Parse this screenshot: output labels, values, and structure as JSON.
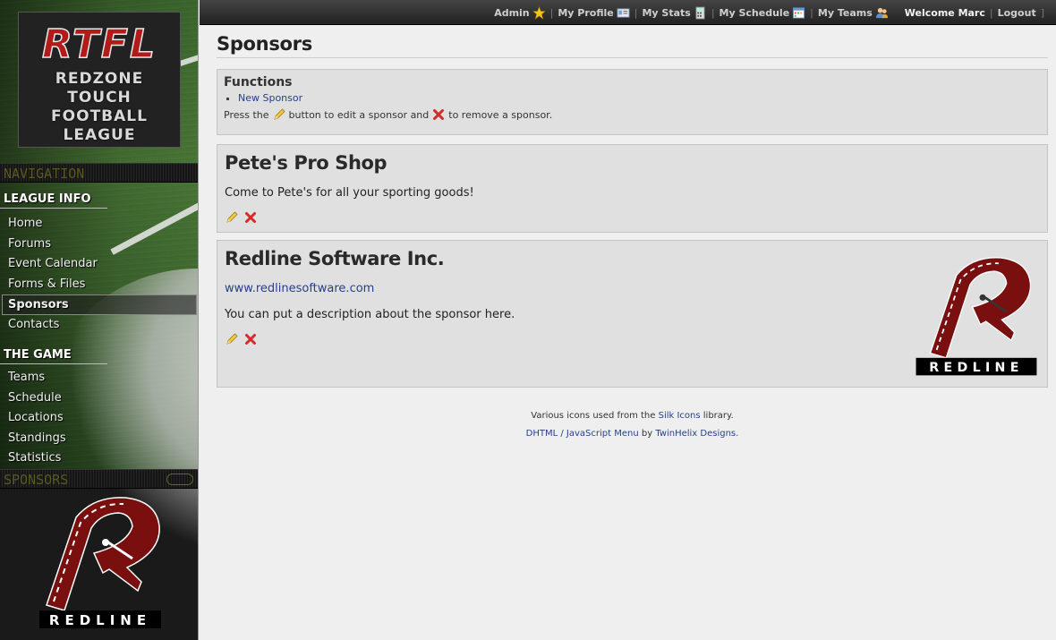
{
  "sidebar": {
    "logo": {
      "abbr": "RTFL",
      "line1": "REDZONE",
      "line2": "TOUCH",
      "line3": "FOOTBALL",
      "line4": "LEAGUE"
    },
    "navigation_bar": "NAVIGATION",
    "league_info": {
      "heading": "LEAGUE INFO",
      "items": [
        "Home",
        "Forums",
        "Event Calendar",
        "Forms & Files",
        "Sponsors",
        "Contacts"
      ],
      "active": "Sponsors"
    },
    "the_game": {
      "heading": "THE GAME",
      "items": [
        "Teams",
        "Schedule",
        "Locations",
        "Standings",
        "Statistics"
      ]
    },
    "sponsors_bar": "SPONSORS",
    "sponsor_logo_text": "REDLINE"
  },
  "topnav": {
    "admin": "Admin",
    "profile": "My Profile",
    "stats": "My Stats",
    "schedule": "My Schedule",
    "teams": "My Teams",
    "welcome": "Welcome Marc",
    "logout": "Logout",
    "icons": [
      "star-icon",
      "id-card-icon",
      "calculator-icon",
      "calendar-icon",
      "user-group-icon"
    ]
  },
  "page": {
    "title": "Sponsors",
    "functions": {
      "heading": "Functions",
      "links": [
        "New Sponsor"
      ],
      "help_prefix": "Press the",
      "help_middle": "button to edit a sponsor and",
      "help_suffix": "to remove a sponsor."
    },
    "sponsors": [
      {
        "name": "Pete's Pro Shop",
        "url": "",
        "description": "Come to Pete's for all your sporting goods!"
      },
      {
        "name": "Redline Software Inc.",
        "url": "www.redlinesoftware.com",
        "description": "You can put a description about the sponsor here.",
        "logo_text": "REDLINE"
      }
    ]
  },
  "footer": {
    "line1_prefix": "Various icons used from the",
    "line1_link": "Silk Icons",
    "line1_suffix": "library.",
    "line2_link": "DHTML / JavaScript Menu",
    "line2_mid": "by",
    "line2_link2": "TwinHelix Designs."
  },
  "colors": {
    "accent_red": "#b31b1b",
    "link_blue": "#263f8a",
    "panel_bg": "#e0e0e0",
    "page_bg": "#efefef"
  }
}
